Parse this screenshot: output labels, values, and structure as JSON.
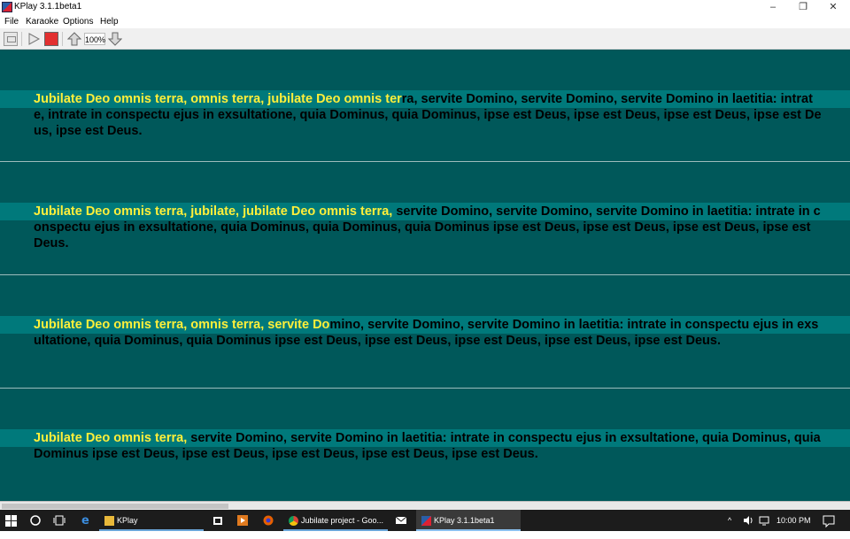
{
  "window": {
    "title": "KPlay 3.1.1beta1",
    "minimize_glyph": "–",
    "maximize_glyph": "❐",
    "close_glyph": "✕"
  },
  "menu": {
    "items": [
      "File",
      "Karaoke",
      "Options",
      "Help"
    ]
  },
  "toolbar": {
    "zoom": "100%"
  },
  "colors": {
    "background": "#00585a",
    "band": "#00797b",
    "sung_text": "#ffef3a",
    "unsung_text": "#000000"
  },
  "lyrics": [
    {
      "sung": "Jubilate Deo omnis terra, omnis terra, jubilate Deo omnis ter",
      "rest": "ra, servite Domino, servite Domino, servite Domino in laetitia: intrate, intrate in conspectu ejus in exsultatione, quia Dominus, quia Dominus, ipse est Deus, ipse est Deus, ipse est Deus, ipse est Deus, ipse est Deus."
    },
    {
      "sung": "Jubilate Deo omnis terra, jubilate, jubilate Deo omnis terra, ",
      "rest": "servite Domino, servite Domino, servite Domino in laetitia: intrate in conspectu ejus in exsultatione, quia Dominus, quia Dominus, quia Dominus ipse est Deus, ipse est Deus, ipse est Deus, ipse est Deus."
    },
    {
      "sung": "Jubilate Deo omnis terra, omnis terra, servite Do",
      "rest": "mino, servite Domino, servite Domino in laetitia: intrate in conspectu ejus in exsultatione, quia Dominus, quia Dominus ipse est Deus, ipse est Deus, ipse est Deus, ipse est Deus, ipse est Deus."
    },
    {
      "sung": "Jubilate Deo omnis terra, ",
      "rest": "servite Domino, servite Domino in laetitia: intrate in conspectu ejus in exsultatione, quia Dominus, quia Dominus ipse est Deus, ipse est Deus, ipse est Deus, ipse est Deus, ipse est Deus."
    }
  ],
  "taskbar": {
    "tasks": [
      "KPlay",
      "Jubilate project - Goo...",
      "KPlay 3.1.1beta1"
    ],
    "time": "10:00 PM",
    "tray_chevron": "^",
    "volume_icon": "speaker-icon"
  }
}
